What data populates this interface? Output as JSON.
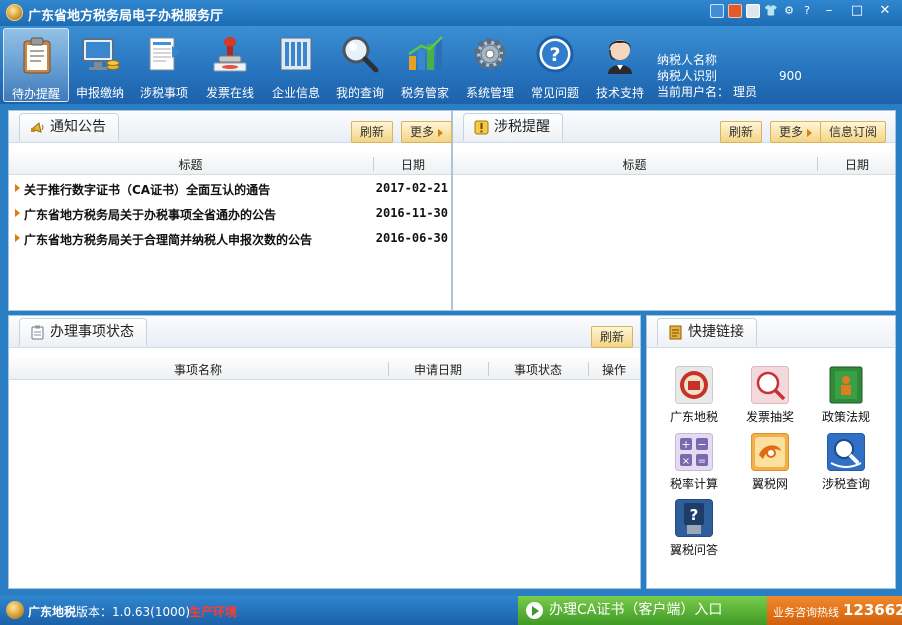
{
  "window": {
    "title": "广东省地方税务局电子办税服务厅",
    "controls": [
      "–",
      "□",
      "✕"
    ]
  },
  "toolbar": {
    "items": [
      {
        "label": "待办提醒",
        "icon": "clipboard-icon"
      },
      {
        "label": "申报缴纳",
        "icon": "monitor-money-icon"
      },
      {
        "label": "涉税事项",
        "icon": "form-document-icon"
      },
      {
        "label": "发票在线",
        "icon": "stamp-icon"
      },
      {
        "label": "企业信息",
        "icon": "building-icon"
      },
      {
        "label": "我的查询",
        "icon": "magnifier-icon"
      },
      {
        "label": "税务管家",
        "icon": "bar-chart-icon"
      },
      {
        "label": "系统管理",
        "icon": "gear-icon"
      },
      {
        "label": "常见问题",
        "icon": "question-icon"
      },
      {
        "label": "技术支持",
        "icon": "support-agent-icon"
      }
    ],
    "active_index": 0
  },
  "taxpayer": {
    "name_label": "纳税人名称",
    "id_label": "纳税人识别",
    "id_suffix": "900",
    "user_label": "当前用户名：",
    "user_value": "理员"
  },
  "notice": {
    "title": "通知公告",
    "refresh": "刷新",
    "more": "更多",
    "col_title": "标题",
    "col_date": "日期",
    "rows": [
      {
        "title": "关于推行数字证书（CA证书）全面互认的通告",
        "date": "2017-02-21"
      },
      {
        "title": "广东省地方税务局关于办税事项全省通办的公告",
        "date": "2016-11-30"
      },
      {
        "title": "广东省地方税务局关于合理简并纳税人申报次数的公告",
        "date": "2016-06-30"
      }
    ]
  },
  "reminder": {
    "title": "涉税提醒",
    "refresh": "刷新",
    "more": "更多",
    "subscribe": "信息订阅",
    "col_title": "标题",
    "col_date": "日期"
  },
  "status_panel": {
    "title": "办理事项状态",
    "refresh": "刷新",
    "col_name": "事项名称",
    "col_apply_date": "申请日期",
    "col_status": "事项状态",
    "col_action": "操作"
  },
  "quicklinks": {
    "title": "快捷链接",
    "items": [
      {
        "label": "广东地税",
        "icon": "tax-emblem-icon"
      },
      {
        "label": "发票抽奖",
        "icon": "lottery-icon"
      },
      {
        "label": "政策法规",
        "icon": "law-book-icon"
      },
      {
        "label": "税率计算",
        "icon": "calculator-icon"
      },
      {
        "label": "翼税网",
        "icon": "wing-tax-icon"
      },
      {
        "label": "涉税查询",
        "icon": "tax-search-icon"
      },
      {
        "label": "翼税问答",
        "icon": "usb-qa-icon"
      }
    ]
  },
  "statusbar": {
    "brand": "广东地税",
    "version": "版本：1.0.63(1000)",
    "env": "生产环境",
    "ca_entry": "办理CA证书（客户端）入口",
    "hotline_label": "业务咨询热线",
    "hotline_number": "123662"
  },
  "colors": {
    "title_blue": "#1f6db4",
    "button_gold": "#f4d486",
    "ca_green": "#3f9a25",
    "hotline_orange": "#d2600c",
    "env_red": "#ff3b2f"
  }
}
